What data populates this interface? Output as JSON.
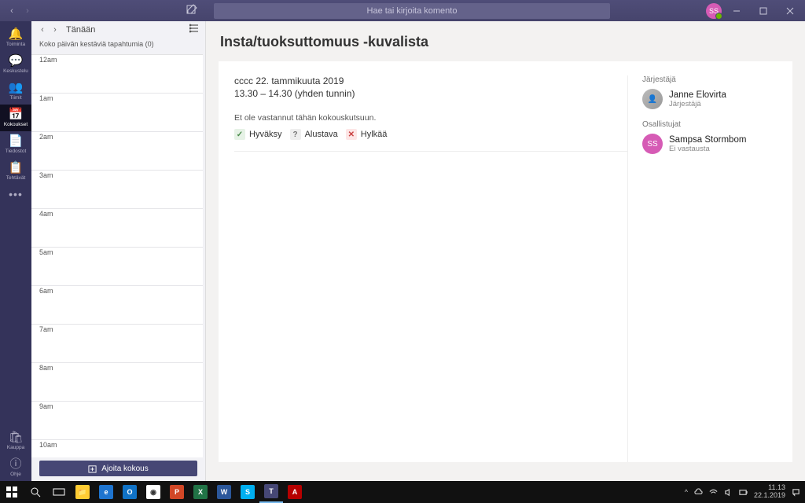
{
  "titlebar": {
    "search_placeholder": "Hae tai kirjoita komento",
    "avatar_initials": "SS"
  },
  "rail": {
    "items": [
      {
        "icon": "🔔",
        "label": "Toiminta"
      },
      {
        "icon": "💬",
        "label": "Keskustelu"
      },
      {
        "icon": "👥",
        "label": "Tiimit"
      },
      {
        "icon": "📅",
        "label": "Kokoukset"
      },
      {
        "icon": "📄",
        "label": "Tiedostot"
      },
      {
        "icon": "📋",
        "label": "Tehtävät"
      }
    ],
    "store_label": "Kauppa",
    "help_label": "Ohje"
  },
  "calendar": {
    "today_label": "Tänään",
    "allday_text": "Koko päivän kestäviä tapahtumia (0)",
    "hours": [
      "12am",
      "1am",
      "2am",
      "3am",
      "4am",
      "5am",
      "6am",
      "7am",
      "8am",
      "9am",
      "10am"
    ],
    "schedule_button": "Ajoita kokous"
  },
  "detail": {
    "title": "Insta/tuoksuttomuus -kuvalista",
    "date_line": "cccc 22. tammikuuta 2019",
    "time_line": "13.30 – 14.30 (yhden tunnin)",
    "not_responded": "Et ole vastannut tähän kokouskutsuun.",
    "accept": "Hyväksy",
    "tentative": "Alustava",
    "decline": "Hylkää",
    "organizer_label": "Järjestäjä",
    "organizer_name": "Janne Elovirta",
    "organizer_role": "Järjestäjä",
    "participants_label": "Osallistujat",
    "participant_name": "Sampsa Stormbom",
    "participant_initials": "SS",
    "participant_status": "Ei vastausta"
  },
  "taskbar": {
    "time": "11.13",
    "date": "22.1.2019"
  }
}
